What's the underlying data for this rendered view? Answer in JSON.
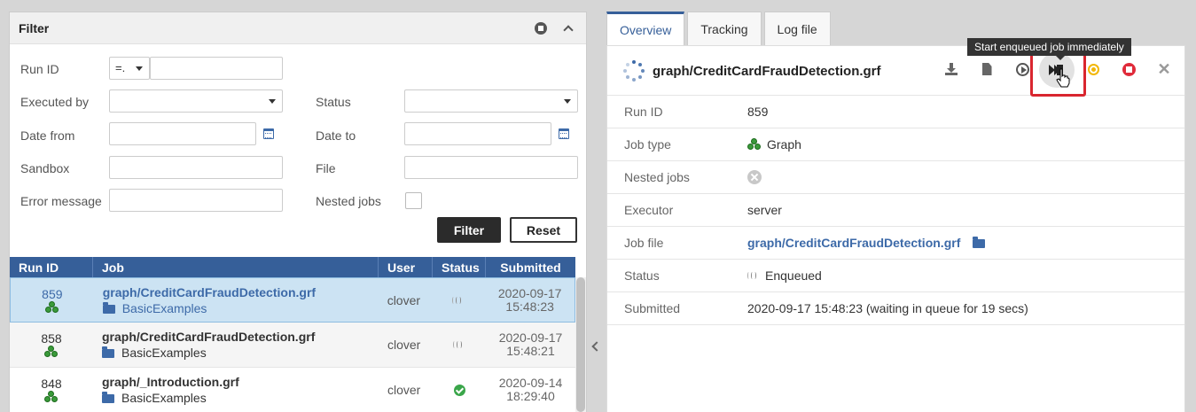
{
  "filter": {
    "title": "Filter",
    "labels": {
      "run_id": "Run ID",
      "executed_by": "Executed by",
      "status": "Status",
      "date_from": "Date from",
      "date_to": "Date to",
      "sandbox": "Sandbox",
      "file": "File",
      "error_message": "Error message",
      "nested_jobs": "Nested jobs"
    },
    "run_id_operator": "=.",
    "filter_button": "Filter",
    "reset_button": "Reset"
  },
  "table": {
    "columns": [
      "Run ID",
      "Job",
      "User",
      "Status",
      "Submitted"
    ],
    "rows": [
      {
        "run_id": "859",
        "job": "graph/CreditCardFraudDetection.grf",
        "sandbox": "BasicExamples",
        "user": "clover",
        "status": "enqueued",
        "date": "2020-09-17",
        "time": "15:48:23"
      },
      {
        "run_id": "858",
        "job": "graph/CreditCardFraudDetection.grf",
        "sandbox": "BasicExamples",
        "user": "clover",
        "status": "enqueued",
        "date": "2020-09-17",
        "time": "15:48:21"
      },
      {
        "run_id": "848",
        "job": "graph/_Introduction.grf",
        "sandbox": "BasicExamples",
        "user": "clover",
        "status": "finished-ok",
        "date": "2020-09-14",
        "time": "18:29:40"
      }
    ]
  },
  "tabs": [
    "Overview",
    "Tracking",
    "Log file"
  ],
  "tooltip": "Start enqueued job immediately",
  "detail": {
    "title": "graph/CreditCardFraudDetection.grf",
    "rows": {
      "run_id": {
        "label": "Run ID",
        "value": "859"
      },
      "job_type": {
        "label": "Job type",
        "value": "Graph"
      },
      "nested_jobs": {
        "label": "Nested jobs"
      },
      "executor": {
        "label": "Executor",
        "value": "server"
      },
      "job_file": {
        "label": "Job file",
        "value": "graph/CreditCardFraudDetection.grf"
      },
      "status": {
        "label": "Status",
        "value": "Enqueued"
      },
      "submitted": {
        "label": "Submitted",
        "value": "2020-09-17 15:48:23 (waiting in queue for 19 secs)"
      }
    }
  },
  "colors": {
    "accent": "#365f99",
    "link": "#3d6aa8",
    "selected_row": "#cce3f3",
    "highlight": "#d9262f"
  }
}
